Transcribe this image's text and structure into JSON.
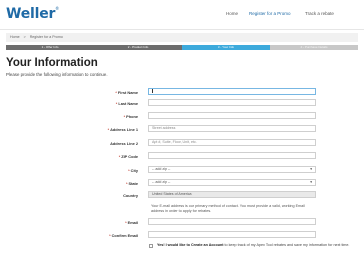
{
  "header": {
    "logo": "Weller",
    "logo_tm": "®",
    "nav": [
      "Home",
      "Register for a Promo",
      "Track a rebate"
    ]
  },
  "breadcrumb": [
    "Home",
    ">",
    "Register for a Promo"
  ],
  "steps": [
    "1 - Offer Info",
    "2 - Product Info",
    "3 - Your Info",
    "4 - Purchase Details"
  ],
  "page": {
    "title": "Your Information",
    "subtitle": "Please provide the following information to continue."
  },
  "form": {
    "first_name": {
      "label": "First Name",
      "value": ""
    },
    "last_name": {
      "label": "Last Name",
      "value": ""
    },
    "phone": {
      "label": "Phone",
      "value": ""
    },
    "address1": {
      "label": "Address Line 1",
      "placeholder": "Street address"
    },
    "address2": {
      "label": "Address Line 2",
      "placeholder": "Apt #, Suite, Floor, Unit, etc."
    },
    "zip": {
      "label": "ZIP Code",
      "value": ""
    },
    "city": {
      "label": "City",
      "value": "-- add zip --"
    },
    "state": {
      "label": "State",
      "value": "-- add zip --"
    },
    "country": {
      "label": "Country",
      "value": "United States of America"
    },
    "email_note": "Your E-mail address is our primary method of contact. You must provide a valid, working Email address in order to apply for rebates.",
    "email": {
      "label": "Email",
      "value": ""
    },
    "confirm_email": {
      "label": "Confirm Email",
      "value": ""
    },
    "account_checkbox": {
      "bold": "Yes! I would like to Create an Account",
      "rest": " to keep track of my Apex Tool rebates and save my information for next time."
    }
  }
}
